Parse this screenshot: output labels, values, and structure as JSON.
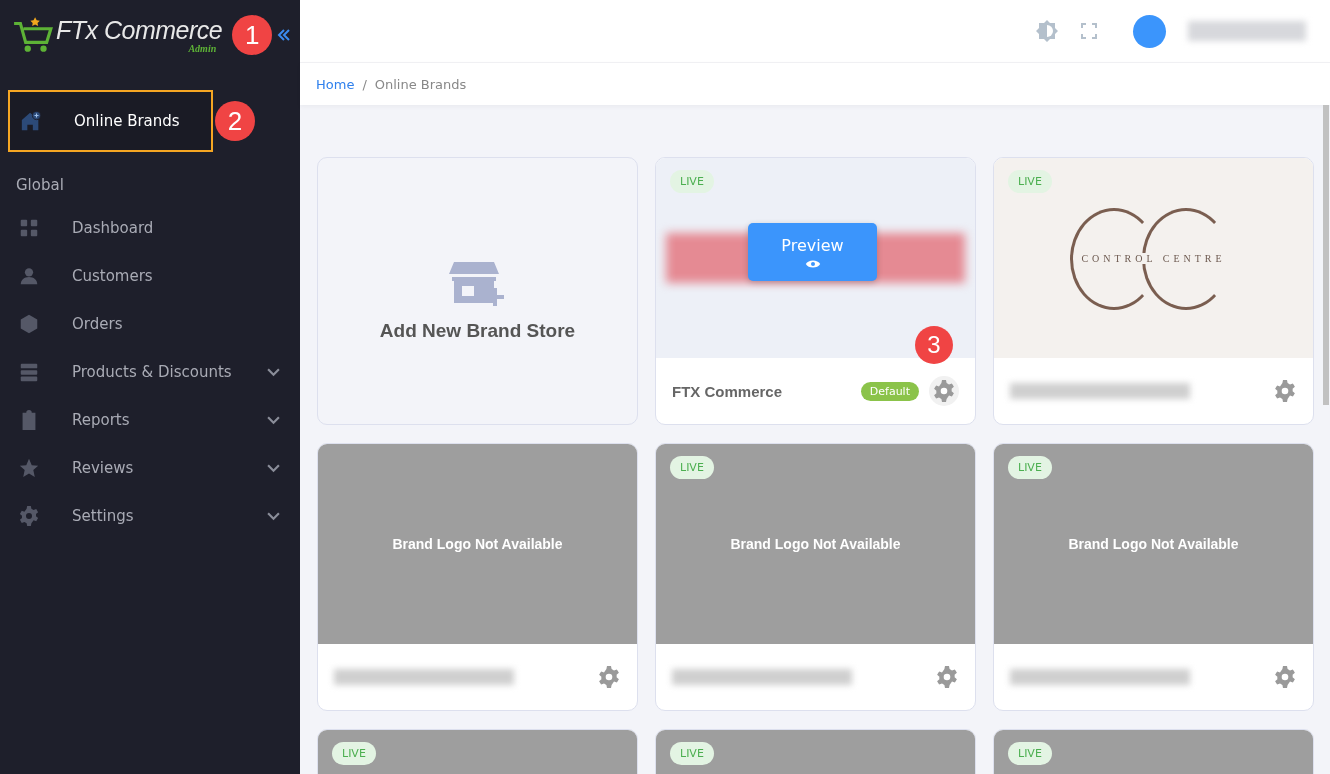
{
  "sidebar": {
    "logo": {
      "name": "FTx Commerce",
      "sub": "Admin"
    },
    "collapse_callout": "1",
    "top_item": {
      "label": "Online Brands",
      "selected": true,
      "callout": "2"
    },
    "section": "Global",
    "items": [
      {
        "label": "Dashboard",
        "kind": "grid",
        "expandable": false
      },
      {
        "label": "Customers",
        "kind": "person",
        "expandable": false
      },
      {
        "label": "Orders",
        "kind": "cube",
        "expandable": false
      },
      {
        "label": "Products & Discounts",
        "kind": "stack",
        "expandable": true
      },
      {
        "label": "Reports",
        "kind": "clipboard",
        "expandable": true
      },
      {
        "label": "Reviews",
        "kind": "star",
        "expandable": true
      },
      {
        "label": "Settings",
        "kind": "gear",
        "expandable": true
      }
    ]
  },
  "breadcrumb": {
    "separator": "/",
    "items": [
      {
        "label": "Home",
        "link": true
      },
      {
        "label": "Online Brands",
        "link": false
      }
    ]
  },
  "cards": [
    {
      "kind": "add",
      "label": "Add New Brand Store"
    },
    {
      "kind": "preview",
      "live": "LIVE",
      "preview": "Preview",
      "name": "FTX Commerce",
      "badge": "Default",
      "callout": "3"
    },
    {
      "kind": "logo",
      "live": "LIVE",
      "logo_text": "CONTROL CENTRE"
    },
    {
      "kind": "nologo",
      "message": "Brand Logo Not Available"
    },
    {
      "kind": "nologo",
      "live": "LIVE",
      "message": "Brand Logo Not Available"
    },
    {
      "kind": "nologo",
      "live": "LIVE",
      "message": "Brand Logo Not Available"
    },
    {
      "kind": "partial",
      "live": "LIVE"
    },
    {
      "kind": "partial",
      "live": "LIVE"
    },
    {
      "kind": "partial",
      "live": "LIVE"
    }
  ]
}
